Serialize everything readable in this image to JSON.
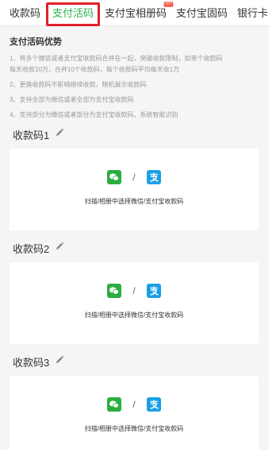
{
  "tabs": [
    {
      "label": "收款码"
    },
    {
      "label": "支付活码"
    },
    {
      "label": "支付宝相册码",
      "badge": "HOT"
    },
    {
      "label": "支付宝固码"
    },
    {
      "label": "银行卡"
    }
  ],
  "advantages": {
    "title": "支付活码优势",
    "lines": [
      "1、将多个微信或者支付宝收款码合并在一起，突破收款限制，如单个收款码",
      "每天收款10万，合并10个收款码，每个收款码平均每天收1万",
      "2、更换收款码不影响继续收款，随机展示收款码",
      "3、支持全部为微信或者全部为支付宝收款码",
      "4、支持部分为微信或者部分为支付宝收款码，系统智能识别"
    ]
  },
  "sections": [
    {
      "title": "收款码1",
      "caption": "扫描/相册中选择微信/支付宝收款码",
      "separator": "/"
    },
    {
      "title": "收款码2",
      "caption": "扫描/相册中选择微信/支付宝收款码",
      "separator": "/"
    },
    {
      "title": "收款码3",
      "caption": "扫描/相册中选择微信/支付宝收款码",
      "separator": "/"
    }
  ],
  "colors": {
    "accent": "#2bb14c",
    "highlight": "#e0202a",
    "wechat": "#2aae3f",
    "alipay": "#1a9fe6"
  },
  "icons": {
    "edit": "pencil-icon",
    "wechat": "wechat-icon",
    "alipay": "alipay-icon"
  }
}
